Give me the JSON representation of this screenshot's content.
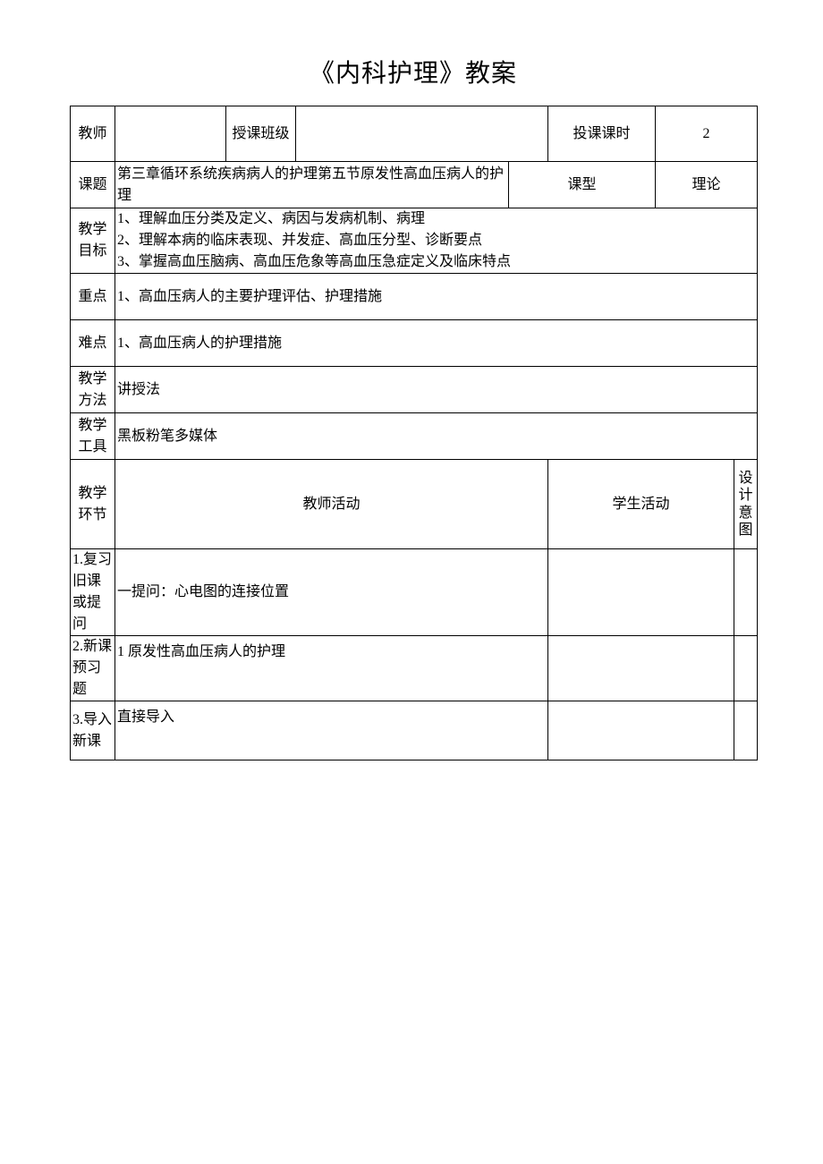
{
  "title": "《内科护理》教案",
  "labels": {
    "teacher": "教师",
    "class": "授课班级",
    "hours": "投课课时",
    "topic": "课题",
    "lesson_type": "课型",
    "objectives": "教学目标",
    "keypoints": "重点",
    "difficulties": "难点",
    "methods": "教学方法",
    "tools": "教学工具",
    "segment": "教学环节",
    "teacher_activity": "教师活动",
    "student_activity": "学生活动",
    "design_intent": "设计意图"
  },
  "values": {
    "teacher": "",
    "class": "",
    "hours": "2",
    "topic": "第三章循环系统疾病病人的护理第五节原发性高血压病人的护理",
    "lesson_type": "理论",
    "objectives": "1、理解血压分类及定义、病因与发病机制、病理\n2、理解本病的临床表现、并发症、高血压分型、诊断要点\n3、掌握高血压脑病、高血压危象等高血压急症定义及临床特点",
    "keypoints": "1、高血压病人的主要护理评估、护理措施",
    "difficulties": "1、高血压病人的护理措施",
    "methods": "讲授法",
    "tools": "黑板粉笔多媒体"
  },
  "segments": [
    {
      "label": "1.复习旧课或提问",
      "teacher": "一提问：心电图的连接位置",
      "student": "",
      "design": ""
    },
    {
      "label": "2.新课预习题",
      "teacher": "1 原发性高血压病人的护理",
      "student": "",
      "design": ""
    },
    {
      "label": "3.导入新课",
      "teacher": "直接导入",
      "student": "",
      "design": ""
    }
  ]
}
